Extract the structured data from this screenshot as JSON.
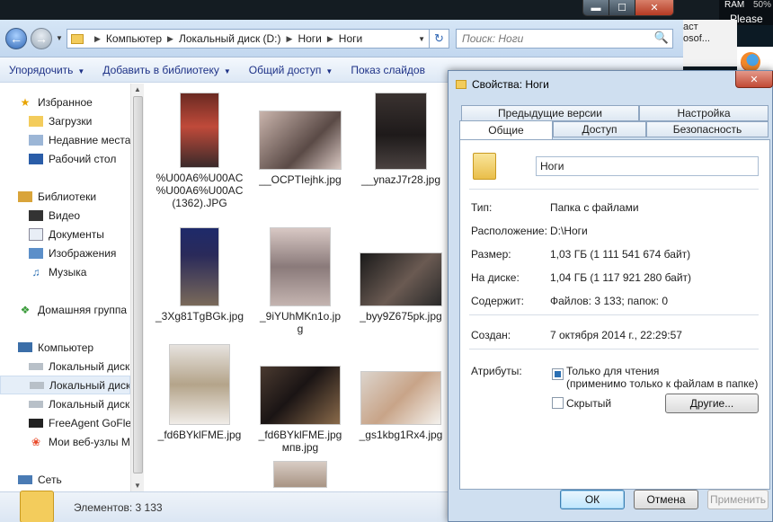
{
  "window": {
    "title_bar_buttons": {
      "minimize": "▬",
      "maximize": "☐",
      "close": "✕"
    }
  },
  "tray": {
    "ram": "RAM",
    "percent": "50%",
    "background_label": "Please"
  },
  "background_window": {
    "text": "аст\nosof...\n"
  },
  "address": {
    "breadcrumbs": [
      "Компьютер",
      "Локальный диск (D:)",
      "Ноги",
      "Ноги"
    ],
    "search_placeholder": "Поиск: Ноги"
  },
  "toolbar": {
    "organize": "Упорядочить",
    "add_library": "Добавить в библиотеку",
    "share": "Общий доступ",
    "slideshow": "Показ слайдов"
  },
  "sidebar": {
    "items": [
      {
        "label": "Избранное",
        "icon": "star-icon"
      },
      {
        "label": "Загрузки",
        "icon": "downloads-folder-icon"
      },
      {
        "label": "Недавние места",
        "icon": "recent-places-icon"
      },
      {
        "label": "Рабочий стол",
        "icon": "desktop-icon"
      },
      {
        "label": "Библиотеки",
        "icon": "libraries-icon"
      },
      {
        "label": "Видео",
        "icon": "video-icon"
      },
      {
        "label": "Документы",
        "icon": "documents-icon"
      },
      {
        "label": "Изображения",
        "icon": "pictures-icon"
      },
      {
        "label": "Музыка",
        "icon": "music-icon"
      },
      {
        "label": "Домашняя группа",
        "icon": "homegroup-icon"
      },
      {
        "label": "Компьютер",
        "icon": "computer-icon"
      },
      {
        "label": "Локальный диск",
        "icon": "drive-c-icon"
      },
      {
        "label": "Локальный диск",
        "icon": "drive-d-icon"
      },
      {
        "label": "Локальный диск",
        "icon": "drive-e-icon"
      },
      {
        "label": "FreeAgent GoFlex",
        "icon": "external-drive-icon"
      },
      {
        "label": "Мои веб-узлы M",
        "icon": "msn-icon"
      },
      {
        "label": "Сеть",
        "icon": "network-icon"
      }
    ]
  },
  "files": [
    {
      "name": "%U00A6%U00AC\n%U00A6%U00AC\n(1362).JPG"
    },
    {
      "name": "__OCPTIejhk.jpg"
    },
    {
      "name": "__ynazJ7r28.jpg"
    },
    {
      "name": "_3Xg81TgBGk.jpg"
    },
    {
      "name": "_9iYUhMKn1o.jp\ng"
    },
    {
      "name": "_byy9Z675pk.jpg"
    },
    {
      "name": "_fd6BYklFME.jpg"
    },
    {
      "name": "_fd6BYklFME.jpg\nмпв.jpg"
    },
    {
      "name": "_gs1kbg1Rx4.jpg"
    }
  ],
  "status": {
    "items": "Элементов: 3 133"
  },
  "dialog": {
    "title": "Свойства: Ноги",
    "close": "✕",
    "tabs": {
      "prev_versions": "Предыдущие версии",
      "customize": "Настройка",
      "general": "Общие",
      "access": "Доступ",
      "security": "Безопасность"
    },
    "name": "Ноги",
    "fields": {
      "type_label": "Тип:",
      "type_value": "Папка с файлами",
      "location_label": "Расположение:",
      "location_value": "D:\\Ноги",
      "size_label": "Размер:",
      "size_value": "1,03 ГБ (1 111 541 674 байт)",
      "disk_label": "На диске:",
      "disk_value": "1,04 ГБ (1 117 921 280 байт)",
      "contains_label": "Содержит:",
      "contains_value": "Файлов: 3 133; папок: 0",
      "created_label": "Создан:",
      "created_value": "7 октября 2014 г., 22:29:57",
      "attributes_label": "Атрибуты:"
    },
    "attributes": {
      "readonly": "Только для чтения",
      "readonly_note": "(применимо только к файлам в папке)",
      "hidden": "Скрытый",
      "other": "Другие..."
    },
    "buttons": {
      "ok": "ОК",
      "cancel": "Отмена",
      "apply": "Применить"
    }
  }
}
